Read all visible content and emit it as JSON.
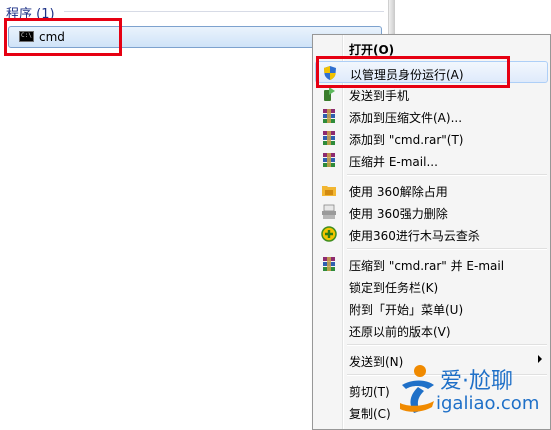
{
  "results": {
    "group_header": "程序 (1)",
    "item": {
      "icon_text": "C:\\",
      "label": "cmd"
    }
  },
  "context_menu": {
    "items": [
      {
        "label": "打开(O)",
        "icon": "none",
        "bold": true
      },
      {
        "label": "以管理员身份运行(A)",
        "icon": "uac-shield-icon",
        "hover": true
      },
      {
        "label": "发送到手机",
        "icon": "phone-send-icon"
      },
      {
        "label": "添加到压缩文件(A)...",
        "icon": "winrar-icon"
      },
      {
        "label": "添加到 \"cmd.rar\"(T)",
        "icon": "winrar-icon"
      },
      {
        "label": "压缩并 E-mail...",
        "icon": "winrar-icon"
      },
      {
        "label": "使用 360解除占用",
        "icon": "unlock-folder-icon"
      },
      {
        "label": "使用 360强力删除",
        "icon": "shredder-icon"
      },
      {
        "label": "使用360进行木马云查杀",
        "icon": "trojan-scan-icon"
      },
      {
        "label": "压缩到 \"cmd.rar\" 并 E-mail",
        "icon": "winrar-icon"
      },
      {
        "label": "锁定到任务栏(K)",
        "icon": "none"
      },
      {
        "label": "附到「开始」菜单(U)",
        "icon": "none"
      },
      {
        "label": "还原以前的版本(V)",
        "icon": "none"
      },
      {
        "label": "发送到(N)",
        "icon": "none",
        "submenu": true
      },
      {
        "label": "剪切(T)",
        "icon": "none"
      },
      {
        "label": "复制(C)",
        "icon": "none"
      }
    ]
  },
  "watermark": {
    "brand": "爱·尬聊",
    "url": "igaliao.com"
  },
  "colors": {
    "highlight_red": "#e60012",
    "header_blue": "#1e3287",
    "watermark_blue": "#1f70c8",
    "watermark_orange": "#f08a00"
  }
}
